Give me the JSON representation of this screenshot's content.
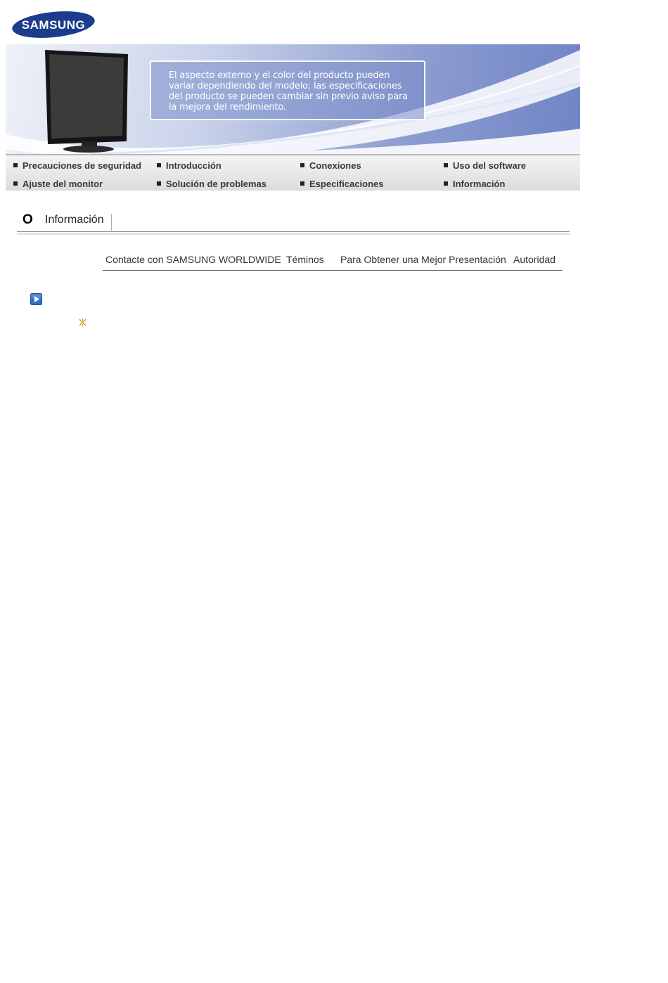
{
  "logo": {
    "text": "SAMSUNG"
  },
  "banner": {
    "notice_lines": [
      "El aspecto externo y el color del producto pueden",
      "variar dependiendo del modelo; las especificaciones",
      "del producto se pueden cambiar sin previo aviso para",
      "la mejora del rendimiento."
    ]
  },
  "menu": {
    "items": [
      "Precauciones de seguridad",
      "Introducción",
      "Conexiones",
      "Uso del software",
      "Ajuste del monitor",
      "Solución de problemas",
      "Especificaciones",
      "Información"
    ]
  },
  "section": {
    "marker": "O",
    "title": "Información"
  },
  "subnav": {
    "links": [
      "Contacte con SAMSUNG WORLDWIDE",
      "Téminos",
      "Para Obtener una Mejor Presentación",
      "Autoridad"
    ]
  },
  "icons": {
    "play": "play-icon",
    "note": "note-icon"
  },
  "colors": {
    "brand_blue": "#1c3c8c",
    "banner_blue": "#6f84c6",
    "note_orange": "#e08a2c"
  }
}
